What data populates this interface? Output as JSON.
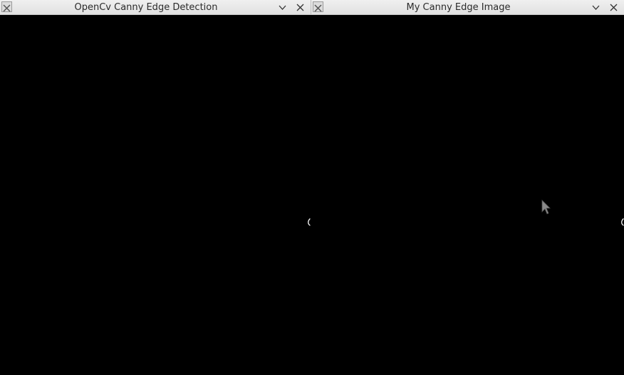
{
  "windows": [
    {
      "title": "OpenCv Canny Edge Detection",
      "app_icon": "x11-app-icon",
      "controls": [
        "chevron-down-icon",
        "close-icon"
      ],
      "content": "canny-edge-image"
    },
    {
      "title": "My Canny Edge Image",
      "app_icon": "x11-app-icon",
      "controls": [
        "chevron-down-icon",
        "close-icon"
      ],
      "content": "canny-edge-image"
    }
  ],
  "colors": {
    "background": "#000000",
    "edges": "#ffffff",
    "titlebar": "#e8e8e8",
    "title_text": "#2b2b2b"
  }
}
